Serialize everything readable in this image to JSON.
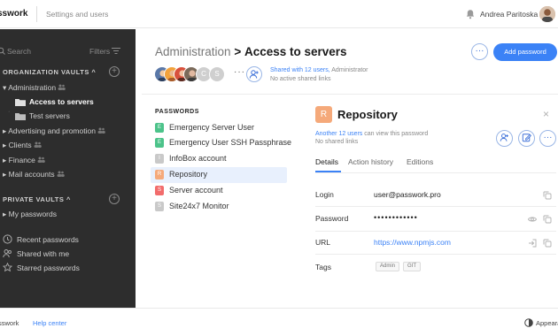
{
  "topbar": {
    "brand": "sswork",
    "settings_link": "Settings and users",
    "user_name": "Andrea Paritoska"
  },
  "sidebar": {
    "search_placeholder": "Search",
    "filters_label": "Filters",
    "org_vaults_heading": "ORGANIZATION VAULTS",
    "org_items": [
      {
        "label": "Administration",
        "level": 0
      },
      {
        "label": "Access to servers",
        "level": 1,
        "active": true
      },
      {
        "label": "Test servers",
        "level": 1
      },
      {
        "label": "Advertising and promotion",
        "level": 0
      },
      {
        "label": "Clients",
        "level": 0
      },
      {
        "label": "Finance",
        "level": 0
      },
      {
        "label": "Mail accounts",
        "level": 0
      }
    ],
    "private_vaults_heading": "PRIVATE VAULTS",
    "private_items": [
      {
        "label": "My passwords"
      }
    ],
    "bottom_links": [
      {
        "label": "Recent passwords",
        "icon": "clock-icon"
      },
      {
        "label": "Shared with me",
        "icon": "users-icon"
      },
      {
        "label": "Starred passwords",
        "icon": "star-icon"
      }
    ]
  },
  "main": {
    "breadcrumb_parent": "Administration",
    "breadcrumb_sep": ">",
    "breadcrumb_current": "Access to servers",
    "add_password_label": "Add password",
    "more_label": "···",
    "avatar_letters": [
      "C",
      "S"
    ],
    "avatars_more": "···",
    "shared_with_link": "Shared with 12 users,",
    "shared_with_rest": "Administrator",
    "no_links_text": "No active shared links"
  },
  "password_list": {
    "heading": "PASSWORDS",
    "items": [
      {
        "label": "Emergency Server User",
        "letter": "E",
        "color": "#4cc38a"
      },
      {
        "label": "Emergency User SSH Passphrase",
        "letter": "E",
        "color": "#4cc38a"
      },
      {
        "label": "InfoBox account",
        "letter": "I",
        "color": "#c9c9c9"
      },
      {
        "label": "Repository",
        "letter": "R",
        "color": "#f5a97a",
        "selected": true
      },
      {
        "label": "Server account",
        "letter": "S",
        "color": "#f26c6c"
      },
      {
        "label": "Site24x7 Monitor",
        "letter": "S",
        "color": "#c9c9c9"
      }
    ]
  },
  "detail": {
    "letter": "R",
    "title": "Repository",
    "close_label": "×",
    "share_link": "Another 12 users",
    "share_rest": "can view this password",
    "no_links_text": "No shared links",
    "tabs": [
      "Details",
      "Action history",
      "Editions"
    ],
    "fields": {
      "login_label": "Login",
      "login_value": "user@passwork.pro",
      "password_label": "Password",
      "password_value": "••••••••••••",
      "url_label": "URL",
      "url_value": "https://www.npmjs.com",
      "tags_label": "Tags"
    },
    "tags": [
      "Admin",
      "GIT"
    ]
  },
  "footer": {
    "brand": "sswork",
    "help_link": "Help center",
    "appearance_label": "Appeara"
  },
  "colors": {
    "accent": "#3b82f6",
    "sidebar_bg": "#2d2d2d",
    "selected_row_bg": "#e8f0fd"
  }
}
